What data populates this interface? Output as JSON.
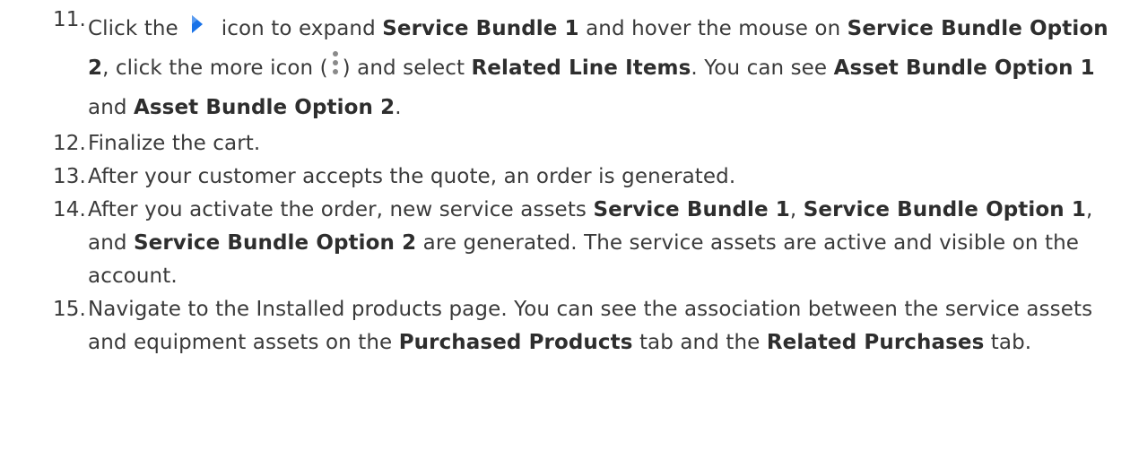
{
  "steps": [
    {
      "num": "11.",
      "t1": "Click the",
      "expand_icon": "expand-arrow-icon",
      "t2": "icon to expand ",
      "b1": "Service Bundle 1",
      "t3": " and hover the mouse on ",
      "b2": "Service Bundle Option 2",
      "t4": ", click the more icon (",
      "more_icon": "more-vertical-icon",
      "t5": ") and select ",
      "b3": "Related Line Items",
      "t6": ". You can see ",
      "b4": "Asset Bundle Option 1",
      "t7": " and ",
      "b5": "Asset Bundle Option 2",
      "t8": "."
    },
    {
      "num": "12.",
      "t1": "Finalize the cart."
    },
    {
      "num": "13.",
      "t1": "After your customer accepts the quote, an order is generated."
    },
    {
      "num": "14.",
      "t1": "After you activate the order, new service assets ",
      "b1": "Service Bundle 1",
      "t2": ", ",
      "b2": "Service Bundle Option 1",
      "t3": ", and ",
      "b3": "Service Bundle Option 2",
      "t4": " are generated. The service assets are active and visible on the account."
    },
    {
      "num": "15.",
      "t1": "Navigate to the Installed products page. You can see the association between the service assets and equipment assets on the ",
      "b1": "Purchased Products",
      "t2": " tab and the ",
      "b2": "Related Purchases",
      "t3": " tab."
    }
  ],
  "colors": {
    "text": "#3a3a3a",
    "icon_blue": "#1a73e8",
    "icon_grey": "#8a8a8a"
  }
}
